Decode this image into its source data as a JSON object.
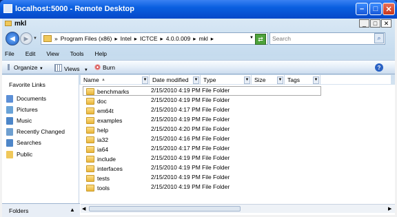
{
  "remote": {
    "title": "localhost:5000 - Remote Desktop"
  },
  "window": {
    "title": "mkl"
  },
  "address": {
    "segments": [
      "Program Files (x86)",
      "Intel",
      "ICTCE",
      "4.0.0.009",
      "mkl"
    ],
    "search_placeholder": "Search"
  },
  "menu": [
    "File",
    "Edit",
    "View",
    "Tools",
    "Help"
  ],
  "toolbar": {
    "organize": "Organize",
    "views": "Views",
    "burn": "Burn"
  },
  "leftpane": {
    "title": "Favorite Links",
    "items": [
      {
        "label": "Documents",
        "icon": "documents-icon"
      },
      {
        "label": "Pictures",
        "icon": "pictures-icon"
      },
      {
        "label": "Music",
        "icon": "music-icon"
      },
      {
        "label": "Recently Changed",
        "icon": "recent-icon"
      },
      {
        "label": "Searches",
        "icon": "search-folder-icon"
      },
      {
        "label": "Public",
        "icon": "public-icon"
      }
    ],
    "folders_label": "Folders"
  },
  "columns": [
    "Name",
    "Date modified",
    "Type",
    "Size",
    "Tags"
  ],
  "rows": [
    {
      "name": "benchmarks",
      "date": "2/15/2010 4:19 PM",
      "type": "File Folder"
    },
    {
      "name": "doc",
      "date": "2/15/2010 4:19 PM",
      "type": "File Folder"
    },
    {
      "name": "em64t",
      "date": "2/15/2010 4:17 PM",
      "type": "File Folder"
    },
    {
      "name": "examples",
      "date": "2/15/2010 4:19 PM",
      "type": "File Folder"
    },
    {
      "name": "help",
      "date": "2/15/2010 4:20 PM",
      "type": "File Folder"
    },
    {
      "name": "ia32",
      "date": "2/15/2010 4:16 PM",
      "type": "File Folder"
    },
    {
      "name": "ia64",
      "date": "2/15/2010 4:17 PM",
      "type": "File Folder"
    },
    {
      "name": "include",
      "date": "2/15/2010 4:19 PM",
      "type": "File Folder"
    },
    {
      "name": "interfaces",
      "date": "2/15/2010 4:19 PM",
      "type": "File Folder"
    },
    {
      "name": "tests",
      "date": "2/15/2010 4:19 PM",
      "type": "File Folder"
    },
    {
      "name": "tools",
      "date": "2/15/2010 4:19 PM",
      "type": "File Folder"
    }
  ]
}
